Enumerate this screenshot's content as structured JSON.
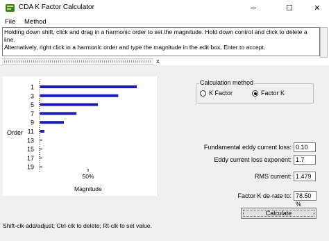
{
  "window": {
    "title": "CDA K Factor Calculator",
    "controls": {
      "minimize": "─",
      "maximize": "☐",
      "close": "✕"
    }
  },
  "menu": [
    "File",
    "Method"
  ],
  "instructions": {
    "line1": "Holding down shift, click and drag in a harmonic order to set the magnitude.  Hold down control and click to delete a line.",
    "line2": "Alternatively, right click in a harmonic order and type the magnitude in the edit box.  Enter to accept."
  },
  "close_x": "x",
  "chart_data": {
    "type": "bar",
    "orientation": "horizontal",
    "categories": [
      "1",
      "3",
      "5",
      "7",
      "9",
      "11",
      "13",
      "15",
      "17",
      "19"
    ],
    "values": [
      100,
      81,
      60,
      38,
      25,
      5,
      0,
      0,
      0,
      0
    ],
    "xlim": [
      0,
      100
    ],
    "xtick_label": "50%",
    "xlabel": "Magnitude",
    "ylabel": "Order",
    "bar_color": "#1c1cb0"
  },
  "calc_method": {
    "legend": "Calculation method",
    "options": [
      {
        "label": "K Factor",
        "selected": false
      },
      {
        "label": "Factor K",
        "selected": true
      }
    ]
  },
  "fields": [
    {
      "label": "Fundamental eddy current loss:",
      "value": "0.10"
    },
    {
      "label": "Eddy current loss exponent:",
      "value": "1.7"
    },
    {
      "label": "RMS current:",
      "value": "1.479"
    },
    {
      "label": "Factor K de-rate to:",
      "value": "78.50 %"
    }
  ],
  "calculate_label": "Calculate",
  "status": "Shift-clk add/adjust; Ctrl-clk to delete; Rt-clk to set value."
}
